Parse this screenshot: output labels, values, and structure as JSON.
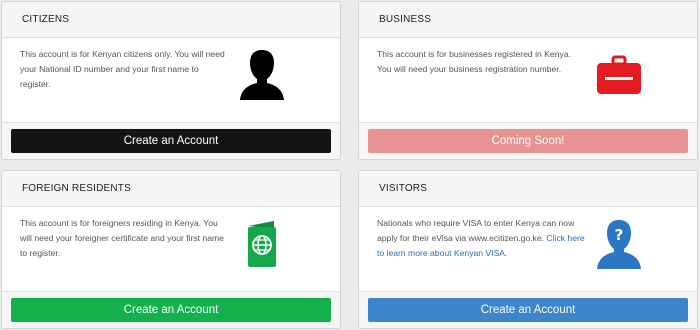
{
  "cards": [
    {
      "title": "CITIZENS",
      "description": "This account is for Kenyan citizens only. You will need your National ID number and your first name to register.",
      "button_label": "Create an Account",
      "icon": "person-silhouette-icon",
      "color": "#141414"
    },
    {
      "title": "BUSINESS",
      "description": "This account is for businesses registered in Kenya. You will need your business registration number.",
      "button_label": "Coming Soon!",
      "icon": "briefcase-icon",
      "color": "#e79391"
    },
    {
      "title": "FOREIGN RESIDENTS",
      "description": "This account is for foreigners residing in Kenya. You will need your foreigner certificate and your first name to register.",
      "button_label": "Create an Account",
      "icon": "passport-icon",
      "color": "#12b14c"
    },
    {
      "title": "VISITORS",
      "description": "Nationals who require VISA to enter Kenya can now apply for their eVisa via www.ecitizen.go.ke.",
      "link_text": "Click here to learn more about Kenyan VISA.",
      "button_label": "Create an Account",
      "icon": "question-person-icon",
      "color": "#3b85cd"
    }
  ]
}
